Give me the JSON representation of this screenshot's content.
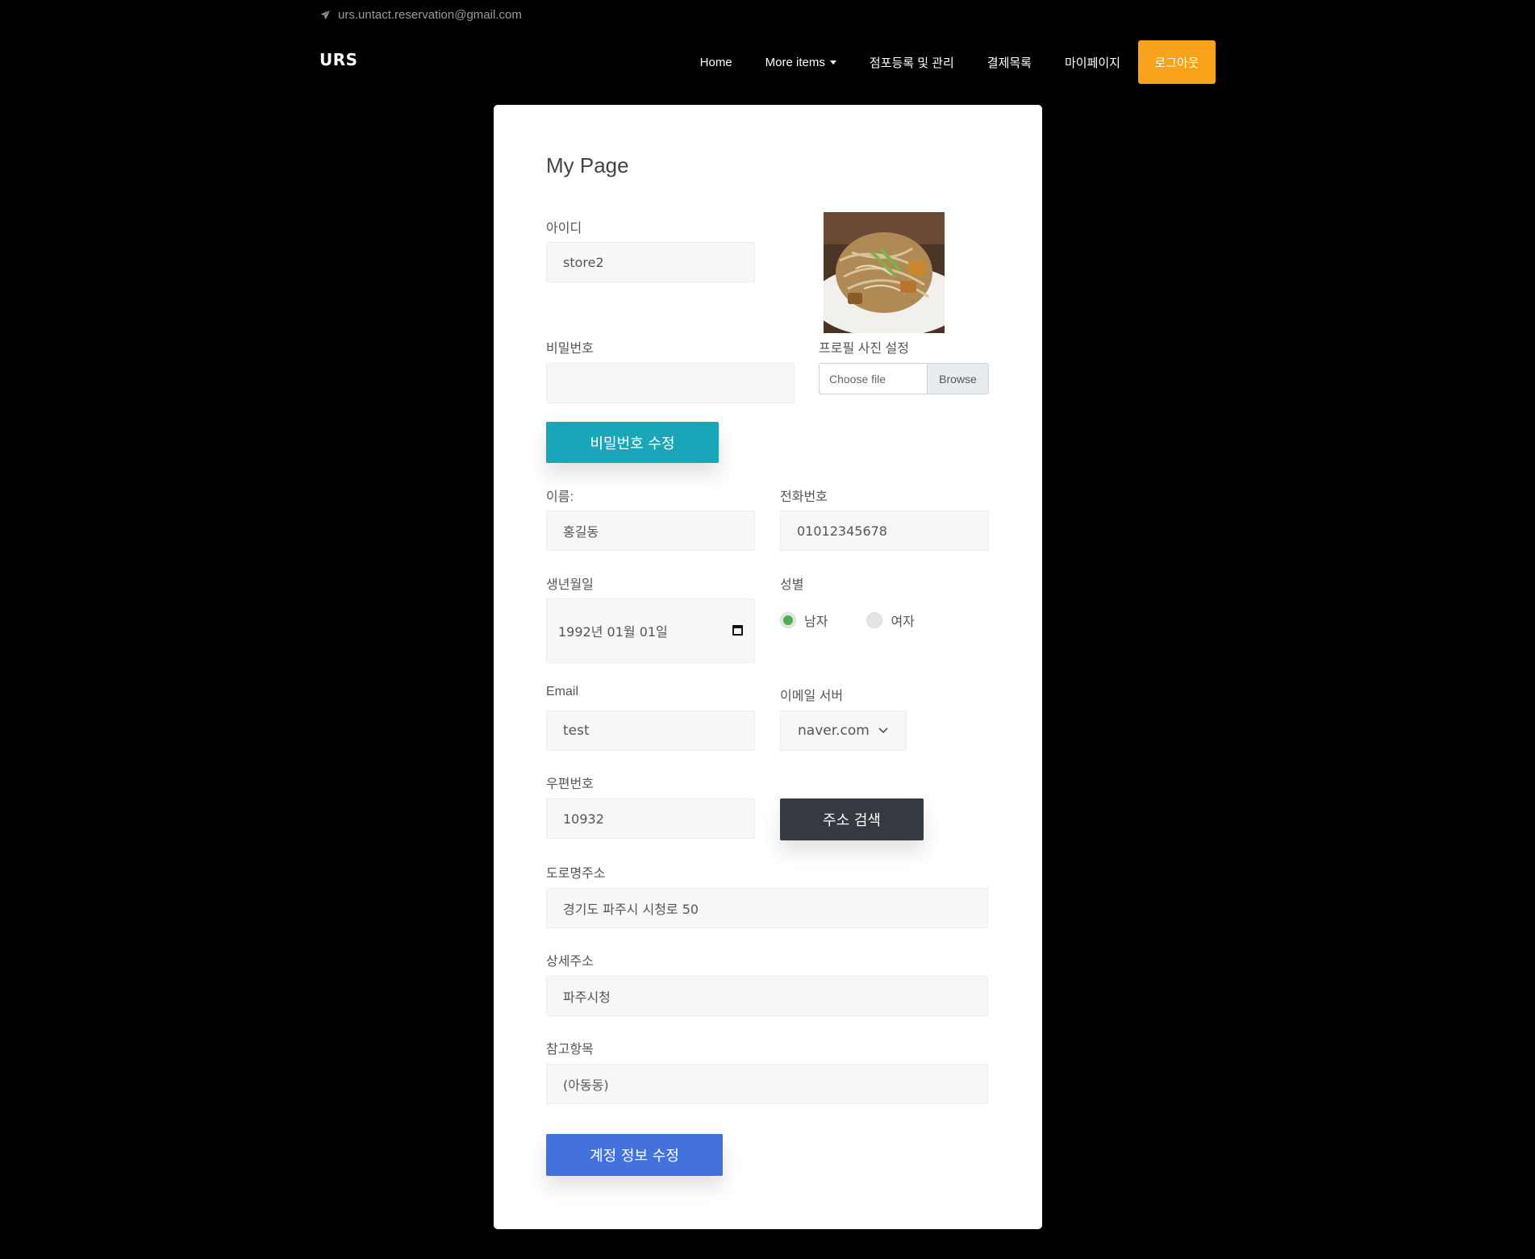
{
  "topbar": {
    "email": "urs.untact.reservation@gmail.com",
    "icon": "paper-plane-icon"
  },
  "nav": {
    "logo": "URS",
    "items": [
      "Home",
      "More items",
      "점포등록 및 관리",
      "결제목록",
      "마이페이지"
    ],
    "logout": "로그아웃",
    "logout_color": "#f8a21c"
  },
  "page": {
    "title": "My Page",
    "id_label": "아이디",
    "id_value": "store2",
    "password_label": "비밀번호",
    "password_value": "",
    "photo_label": "프로필 사진 설정",
    "file_choose": "Choose file",
    "file_browse": "Browse",
    "password_button": "비밀번호 수정",
    "name_label": "이름:",
    "name_value": "홍길동",
    "phone_label": "전화번호",
    "phone_value": "01012345678",
    "birth_label": "생년월일",
    "birth_value": "1992년 01월 01일",
    "gender_label": "성별",
    "gender_options": [
      "남자",
      "여자"
    ],
    "gender_selected": "남자",
    "email_label": "Email",
    "email_value": "test",
    "email_server_label": "이메일 서버",
    "email_server_value": "naver.com",
    "zip_label": "우편번호",
    "zip_value": "10932",
    "address_search_button": "주소 검색",
    "road_label": "도로명주소",
    "road_value": "경기도 파주시 시청로 50",
    "detail_label": "상세주소",
    "detail_value": "파주시청",
    "ref_label": "참고항목",
    "ref_value": "(아동동)",
    "save_button": "계정 정보 수정"
  },
  "colors": {
    "teal": "#1aa6b9",
    "dark": "#343a40",
    "blue": "#4472dc",
    "radio_on": "#4caf50"
  }
}
